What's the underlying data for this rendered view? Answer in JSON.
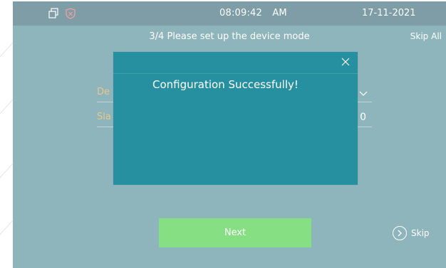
{
  "status_bar": {
    "time": "08:09:42",
    "ampm": "AM",
    "date": "17-11-2021",
    "icons": [
      "duplicate-window-icon",
      "shield-alert-icon"
    ]
  },
  "header": {
    "step_title": "3/4 Please set up the device mode",
    "skip_all_label": "Skip All"
  },
  "form": {
    "row1_label_partial": "De",
    "row2_label_partial": "Sla",
    "row2_value_partial": "0"
  },
  "dialog": {
    "message": "Configuration Successfully!"
  },
  "footer": {
    "next_label": "Next",
    "skip_label": "Skip"
  },
  "colors": {
    "screen_bg": "#8fb5bc",
    "status_bar_bg": "#7e9da6",
    "dialog_bg": "#2790a0",
    "next_button_bg": "#86e083",
    "label_color": "#e8c78c"
  }
}
